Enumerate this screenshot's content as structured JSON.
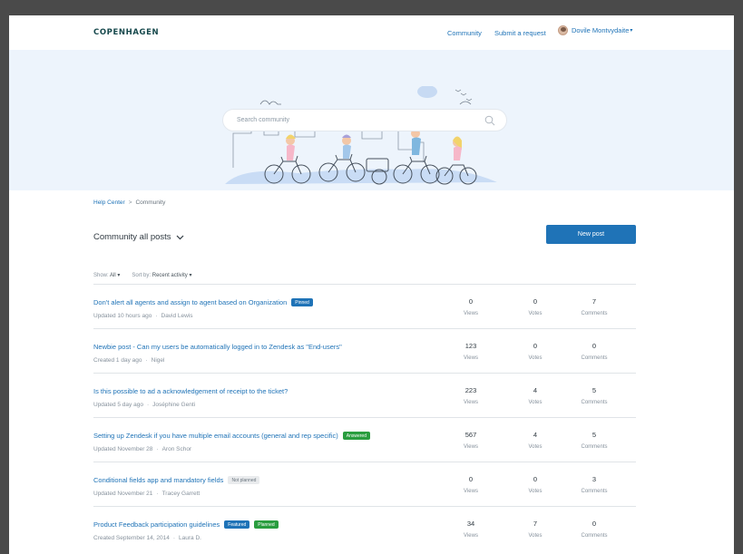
{
  "header": {
    "logo": "COPENHAGEN",
    "nav_community": "Community",
    "nav_submit": "Submit a request",
    "user_name": "Dovile Montvydaite"
  },
  "search": {
    "placeholder": "Search community"
  },
  "breadcrumb": {
    "home": "Help Center",
    "current": "Community"
  },
  "page": {
    "title": "Community all posts",
    "new_post_label": "New post"
  },
  "filters": {
    "show_label": "Show:",
    "show_value": "All",
    "sort_label": "Sort by:",
    "sort_value": "Recent activity"
  },
  "labels": {
    "views": "Views",
    "votes": "Votes",
    "comments": "Comments"
  },
  "posts": [
    {
      "title": "Don't alert all agents and assign to agent based on Organization",
      "badges": [
        {
          "text": "Pinned",
          "kind": "pinned"
        }
      ],
      "meta": "Updated 10 hours ago",
      "author": "David Lewis",
      "views": "0",
      "votes": "0",
      "comments": "7"
    },
    {
      "title": "Newbie post - Can my users be automatically logged in to Zendesk as \"End-users\"",
      "badges": [],
      "meta": "Created 1 day ago",
      "author": "Nigel",
      "views": "123",
      "votes": "0",
      "comments": "0"
    },
    {
      "title": "Is this possible to ad a acknowledgement of receipt to the ticket?",
      "badges": [],
      "meta": "Updated 5 day ago",
      "author": "Joséphine Genti",
      "views": "223",
      "votes": "4",
      "comments": "5"
    },
    {
      "title": "Setting up Zendesk if you have multiple email accounts (general and rep specific)",
      "badges": [
        {
          "text": "Answered",
          "kind": "answered"
        }
      ],
      "meta": "Updated November 28",
      "author": "Aron Schor",
      "views": "567",
      "votes": "4",
      "comments": "5"
    },
    {
      "title": "Conditional fields app and mandatory fields",
      "badges": [
        {
          "text": "Not planned",
          "kind": "not-planned"
        }
      ],
      "meta": "Updated November 21",
      "author": "Tracey Garrett",
      "views": "0",
      "votes": "0",
      "comments": "3"
    },
    {
      "title": "Product Feedback participation guidelines",
      "badges": [
        {
          "text": "Featured",
          "kind": "featured"
        },
        {
          "text": "Planned",
          "kind": "planned"
        }
      ],
      "meta": "Created September 14, 2014",
      "author": "Laura D.",
      "views": "34",
      "votes": "7",
      "comments": "0"
    }
  ],
  "colors": {
    "accent": "#1f73b7",
    "hero_bg": "#edf4fc",
    "answered": "#2a9d3f"
  },
  "icons": {
    "search": "search-icon",
    "chevron": "chevron-down-icon"
  }
}
